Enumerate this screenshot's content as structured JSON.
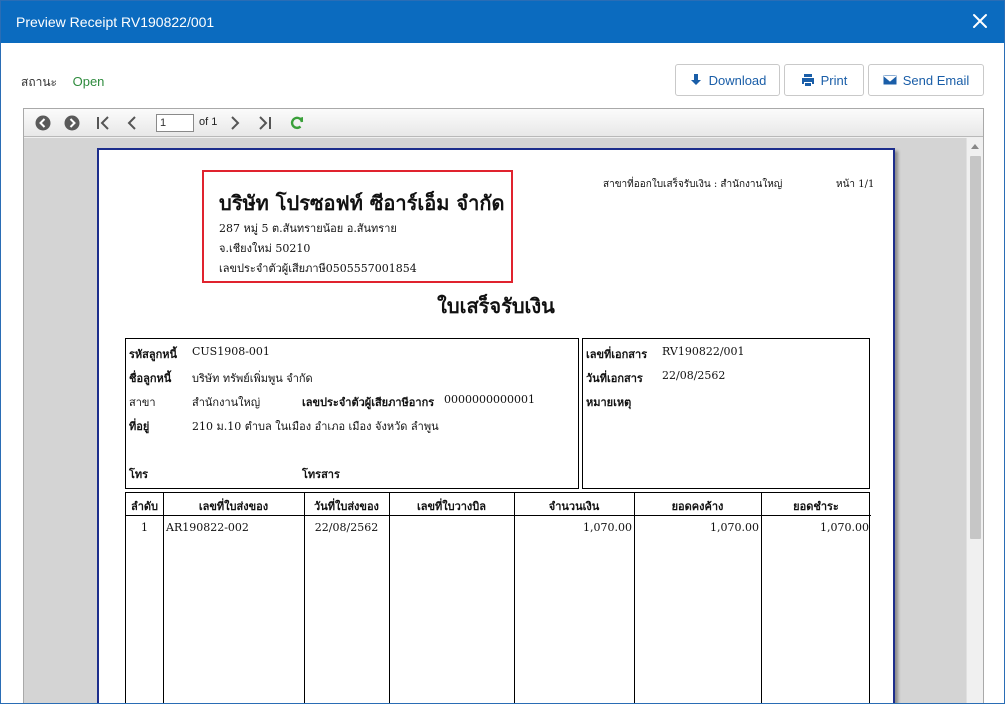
{
  "window": {
    "title": "Preview Receipt RV190822/001"
  },
  "status": {
    "label": "สถานะ",
    "value": "Open"
  },
  "actions": {
    "download": "Download",
    "print": "Print",
    "email": "Send Email"
  },
  "viewer": {
    "page_value": "1",
    "page_of": "of 1"
  },
  "receipt": {
    "company_name": "บริษัท โปรซอฟท์ ซีอาร์เอ็ม จำกัด",
    "address1": "287 หมู่ 5 ต.สันทรายน้อย อ.สันทราย",
    "address2": "จ.เชียงใหม่ 50210",
    "tax_id_line": "เลขประจำตัวผู้เสียภาษี0505557001854",
    "branch_header": "สาขาที่ออกใบเสร็จรับเงิน : สำนักงานใหญ่",
    "page_no": "หน้า 1/1",
    "doc_title": "ใบเสร็จรับเงิน",
    "customer": {
      "code_label": "รหัสลูกหนี้",
      "code_value": "CUS1908-001",
      "name_label": "ชื่อลูกหนี้",
      "name_value": "บริษัท ทรัพย์เพิ่มพูน จำกัด",
      "branch_label": "สาขา",
      "branch_value": "สำนักงานใหญ่",
      "tax_label": "เลขประจำตัวผู้เสียภาษีอากร",
      "tax_value": "0000000000001",
      "address_label": "ที่อยู่",
      "address_value": "210 ม.10 ตำบล ในเมือง อำเภอ เมือง จังหวัด ลำพูน",
      "tel_label": "โทร",
      "fax_label": "โทรสาร"
    },
    "document": {
      "doc_no_label": "เลขที่เอกสาร",
      "doc_no_value": "RV190822/001",
      "date_label": "วันที่เอกสาร",
      "date_value": "22/08/2562",
      "remark_label": "หมายเหตุ"
    },
    "table": {
      "headers": [
        "ลำดับ",
        "เลขที่ใบส่งของ",
        "วันที่ใบส่งของ",
        "เลขที่ใบวางบิล",
        "จำนวนเงิน",
        "ยอดคงค้าง",
        "ยอดชำระ"
      ],
      "rows": [
        [
          "1",
          "AR190822-002",
          "22/08/2562",
          "",
          "1,070.00",
          "1,070.00",
          "1,070.00"
        ]
      ]
    }
  }
}
